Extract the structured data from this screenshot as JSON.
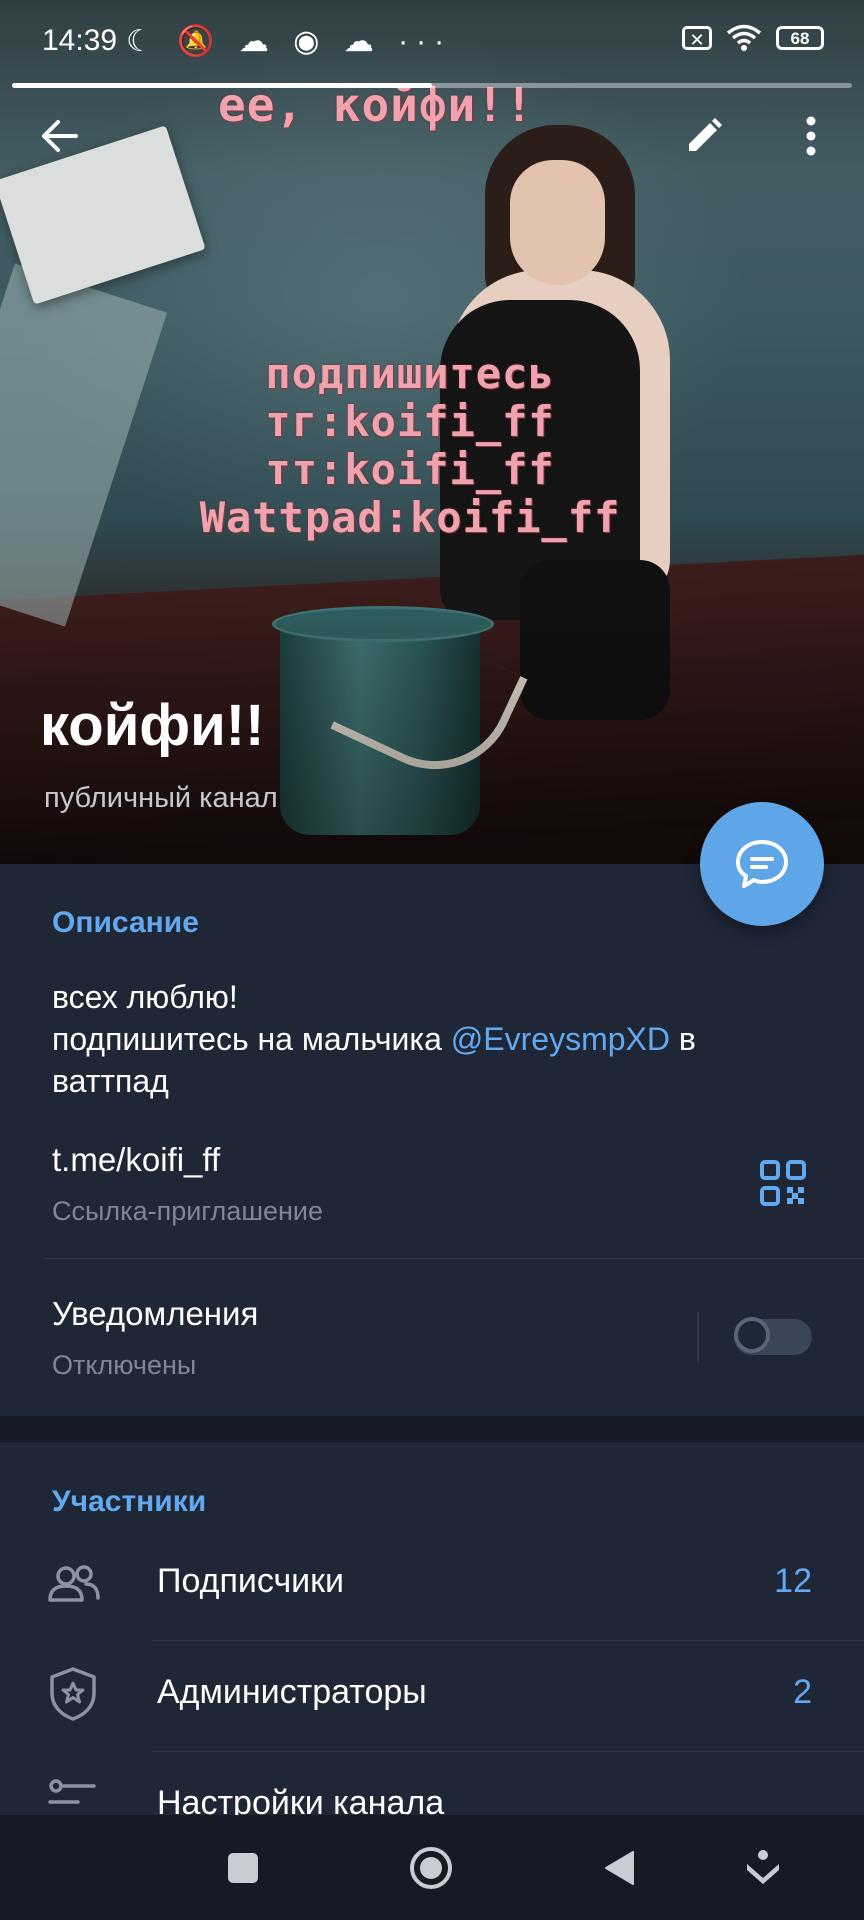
{
  "status_bar": {
    "time": "14:39",
    "left_icons": "☾ 🔕 ☁ ◉ ☁ ···",
    "battery": "68",
    "close_box": "✕"
  },
  "hero": {
    "overlay_top": "ее, койфи!!",
    "overlay_lines": "подпишитесь\nтг:koifi_ff\nтт:koifi_ff\nWattpad:koifi_ff",
    "channel_title": "койфи!!",
    "channel_subtitle": "публичный канал",
    "story_progress": 0.5
  },
  "info": {
    "section_title": "Описание",
    "description_line1": "всех люблю!",
    "description_line2_prefix": "подпишитесь на мальчика ",
    "description_mention": "@EvreysmpXD",
    "description_line2_suffix": " в",
    "description_line3": "ваттпад",
    "link_value": "t.me/koifi_ff",
    "link_label": "Ссылка-приглашение",
    "notifications_title": "Уведомления",
    "notifications_state": "Отключены",
    "notifications_enabled": false
  },
  "members": {
    "section_title": "Участники",
    "items": [
      {
        "label": "Подписчики",
        "count": "12",
        "icon": "people-icon"
      },
      {
        "label": "Администраторы",
        "count": "2",
        "icon": "admin-shield-icon"
      },
      {
        "label": "Настройки канала",
        "count": "",
        "icon": "settings-sliders-icon"
      }
    ]
  },
  "colors": {
    "accent": "#63a9f0",
    "background": "#1f2636",
    "fab": "#5fa6e8"
  }
}
